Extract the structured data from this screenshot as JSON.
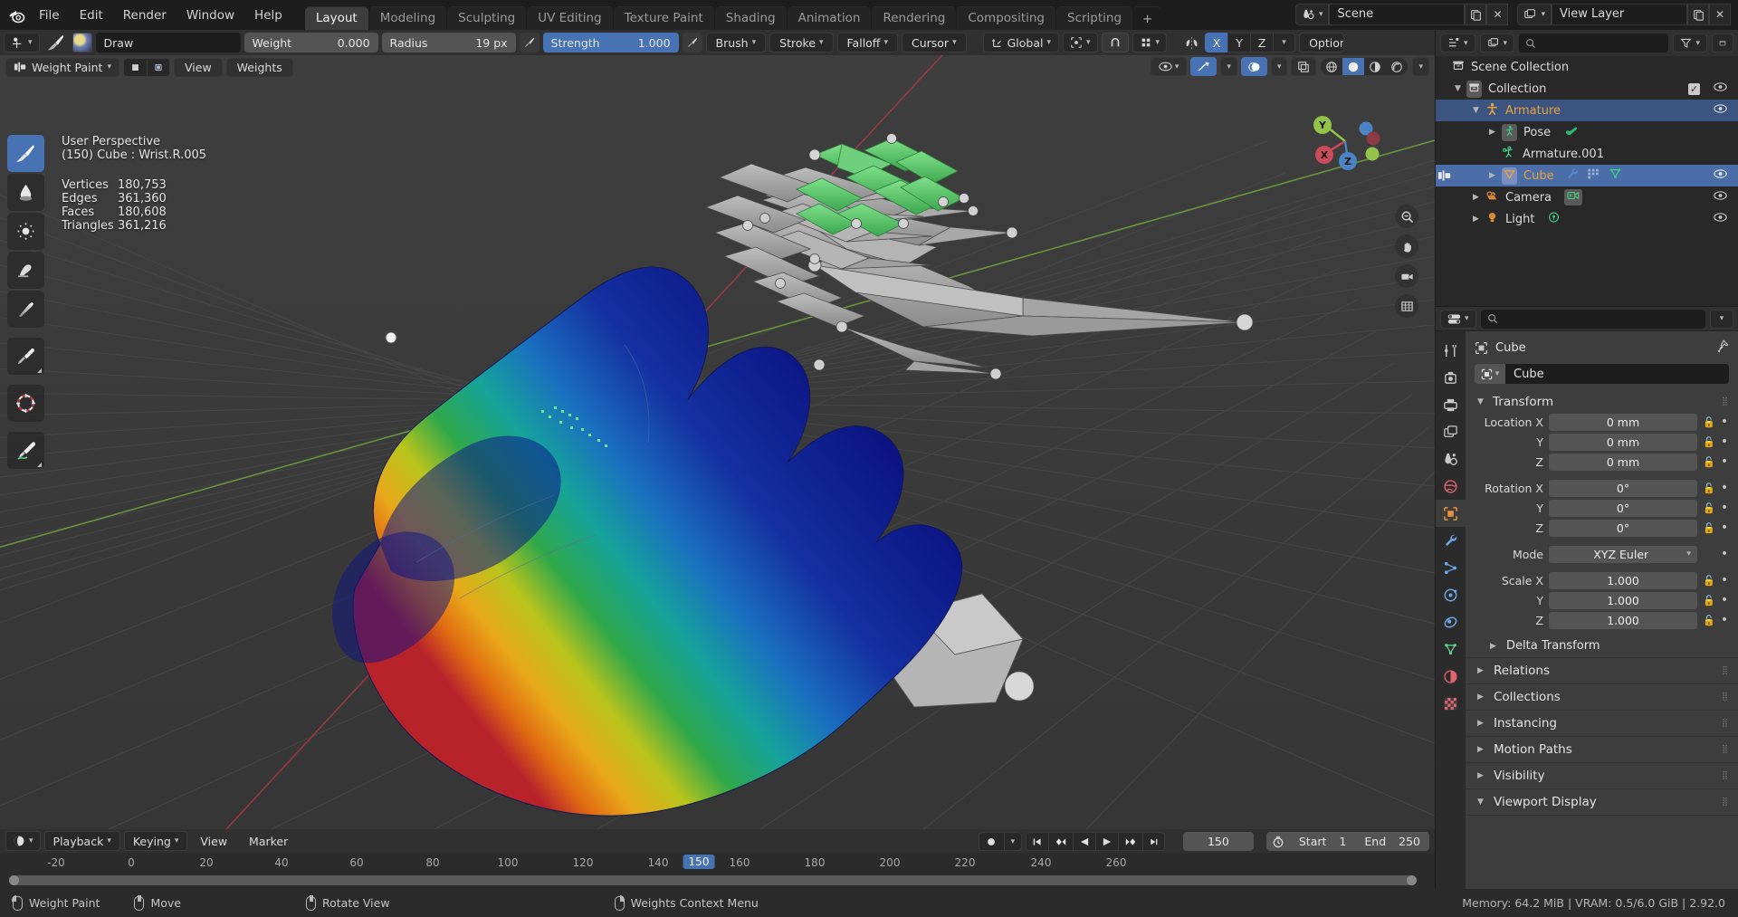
{
  "topbar": {
    "logo": "blender-logo",
    "menus": [
      "File",
      "Edit",
      "Render",
      "Window",
      "Help"
    ],
    "workspaces": [
      {
        "label": "Layout",
        "active": true
      },
      {
        "label": "Modeling",
        "active": false
      },
      {
        "label": "Sculpting",
        "active": false
      },
      {
        "label": "UV Editing",
        "active": false
      },
      {
        "label": "Texture Paint",
        "active": false
      },
      {
        "label": "Shading",
        "active": false
      },
      {
        "label": "Animation",
        "active": false
      },
      {
        "label": "Rendering",
        "active": false
      },
      {
        "label": "Compositing",
        "active": false
      },
      {
        "label": "Scripting",
        "active": false
      }
    ],
    "add_workspace": "+",
    "scene_name": "Scene",
    "view_layer_name": "View Layer"
  },
  "tool_header": {
    "tool_icon": "brush-cursor-icon",
    "brush_icon": "paintbrush-icon",
    "brush_name": "Draw",
    "weight_label": "Weight",
    "weight_value": "0.000",
    "radius_label": "Radius",
    "radius_value": "19 px",
    "strength_label": "Strength",
    "strength_value": "1.000",
    "menus": [
      "Brush",
      "Stroke",
      "Falloff",
      "Cursor"
    ],
    "orientation": "Global",
    "symmetry": {
      "x": "X",
      "y": "Y",
      "z": "Z",
      "x_on": true,
      "y_on": false,
      "z_on": false
    },
    "options_label": "Option"
  },
  "viewport": {
    "mode": "Weight Paint",
    "menus": [
      "View",
      "Weights"
    ],
    "overlay_text": {
      "perspective": "User Perspective",
      "object_line": "(150) Cube : Wrist.R.005"
    },
    "stats": [
      {
        "label": "Vertices",
        "value": "180,753"
      },
      {
        "label": "Edges",
        "value": "361,360"
      },
      {
        "label": "Faces",
        "value": "180,608"
      },
      {
        "label": "Triangles",
        "value": "361,216"
      }
    ],
    "tools": [
      {
        "name": "draw-brush-tool",
        "selected": true
      },
      {
        "name": "blur-tool",
        "selected": false
      },
      {
        "name": "average-tool",
        "selected": false
      },
      {
        "name": "smear-tool",
        "selected": false
      },
      {
        "name": "gradient-tool",
        "selected": false
      },
      {
        "name": "sample-weight-eyedropper-tool",
        "selected": false
      },
      {
        "name": "cursor-tool",
        "selected": false
      },
      {
        "name": "annotate-tool",
        "selected": false
      }
    ],
    "gizmo_axes": [
      "X",
      "Y",
      "Z"
    ],
    "colors": {
      "axis_x": "#cc4a5a",
      "axis_y": "#94c34a",
      "axis_z": "#4a84c4",
      "accent": "#4772b3"
    }
  },
  "timeline": {
    "editor_icon": "clock-icon",
    "menus": [
      "Playback",
      "Keying",
      "View",
      "Marker"
    ],
    "current_frame": "150",
    "start_label": "Start",
    "start_value": "1",
    "end_label": "End",
    "end_value": "250",
    "ticks": [
      "-20",
      "0",
      "20",
      "40",
      "60",
      "80",
      "100",
      "120",
      "140",
      "160",
      "180",
      "200",
      "220",
      "240",
      "260"
    ],
    "playhead_label": "150"
  },
  "statusbar": {
    "items": [
      {
        "mouse": "left",
        "label": "Weight Paint"
      },
      {
        "mouse": "middle",
        "label": "Move"
      },
      {
        "mouse": "middle",
        "label": "Rotate View"
      },
      {
        "mouse": "right",
        "label": "Weights Context Menu"
      }
    ],
    "memory": "Memory: 64.2 MiB | VRAM: 0.5/6.0 GiB | 2.92.0"
  },
  "outliner": {
    "display_mode_icon": "outliner-display-mode-icon",
    "filter_icon": "filter-icon",
    "search_placeholder": "",
    "rows": [
      {
        "label": "Scene Collection",
        "icon": "collection-icon",
        "indent": 0,
        "arrow": "",
        "state": "none",
        "eye": false,
        "check": false
      },
      {
        "label": "Collection",
        "icon": "collection-icon",
        "indent": 1,
        "arrow": "down",
        "state": "none",
        "eye": true,
        "check": true
      },
      {
        "label": "Armature",
        "icon": "armature-icon",
        "indent": 2,
        "arrow": "down",
        "state": "selected",
        "eye": true,
        "check": false
      },
      {
        "label": "Pose",
        "icon": "pose-icon",
        "indent": 3,
        "arrow": "right",
        "state": "none",
        "eye": false,
        "check": false
      },
      {
        "label": "Armature.001",
        "icon": "armature-data-icon",
        "indent": 4,
        "arrow": "",
        "state": "none",
        "eye": false,
        "check": false
      },
      {
        "label": "Cube",
        "icon": "mesh-object-icon",
        "indent": 3,
        "arrow": "right",
        "state": "active",
        "eye": true,
        "check": false
      },
      {
        "label": "Camera",
        "icon": "camera-icon",
        "indent": 2,
        "arrow": "right",
        "state": "none",
        "eye": true,
        "check": false
      },
      {
        "label": "Light",
        "icon": "light-icon",
        "indent": 2,
        "arrow": "right",
        "state": "none",
        "eye": true,
        "check": false
      }
    ]
  },
  "properties": {
    "editor_icon": "properties-editor-icon",
    "search_placeholder": "",
    "breadcrumb": "Cube",
    "pin_icon": "pin-icon",
    "object_name": "Cube",
    "tabs": [
      {
        "name": "tool-tab",
        "selected": false,
        "color": "#c8c8c8"
      },
      {
        "name": "render-tab",
        "selected": false,
        "color": "#c8c8c8"
      },
      {
        "name": "output-tab",
        "selected": false,
        "color": "#c8c8c8"
      },
      {
        "name": "view-layer-tab",
        "selected": false,
        "color": "#c8c8c8"
      },
      {
        "name": "scene-tab",
        "selected": false,
        "color": "#c8c8c8"
      },
      {
        "name": "world-tab",
        "selected": false,
        "color": "#e0646e"
      },
      {
        "name": "object-tab",
        "selected": true,
        "color": "#e8903a"
      },
      {
        "name": "modifier-tab",
        "selected": false,
        "color": "#6fa8e8"
      },
      {
        "name": "particles-tab",
        "selected": false,
        "color": "#6fa8e8"
      },
      {
        "name": "physics-tab",
        "selected": false,
        "color": "#6fa8e8"
      },
      {
        "name": "constraints-tab",
        "selected": false,
        "color": "#6fa8e8"
      },
      {
        "name": "object-data-tab",
        "selected": false,
        "color": "#5ecf8f"
      },
      {
        "name": "material-tab",
        "selected": false,
        "color": "#e0646e"
      },
      {
        "name": "texture-tab",
        "selected": false,
        "color": "#e0646e"
      }
    ],
    "transform": {
      "title": "Transform",
      "location": {
        "label": "Location X",
        "x": "0 mm",
        "y": "0 mm",
        "z": "0 mm"
      },
      "rotation": {
        "label": "Rotation X",
        "x": "0°",
        "y": "0°",
        "z": "0°"
      },
      "mode_label": "Mode",
      "mode_value": "XYZ Euler",
      "scale": {
        "label": "Scale X",
        "x": "1.000",
        "y": "1.000",
        "z": "1.000"
      },
      "axis_y": "Y",
      "axis_z": "Z",
      "delta_transform": "Delta Transform"
    },
    "sections": [
      {
        "label": "Relations",
        "open": false
      },
      {
        "label": "Collections",
        "open": false
      },
      {
        "label": "Instancing",
        "open": false
      },
      {
        "label": "Motion Paths",
        "open": false
      },
      {
        "label": "Visibility",
        "open": false
      },
      {
        "label": "Viewport Display",
        "open": true
      }
    ]
  }
}
